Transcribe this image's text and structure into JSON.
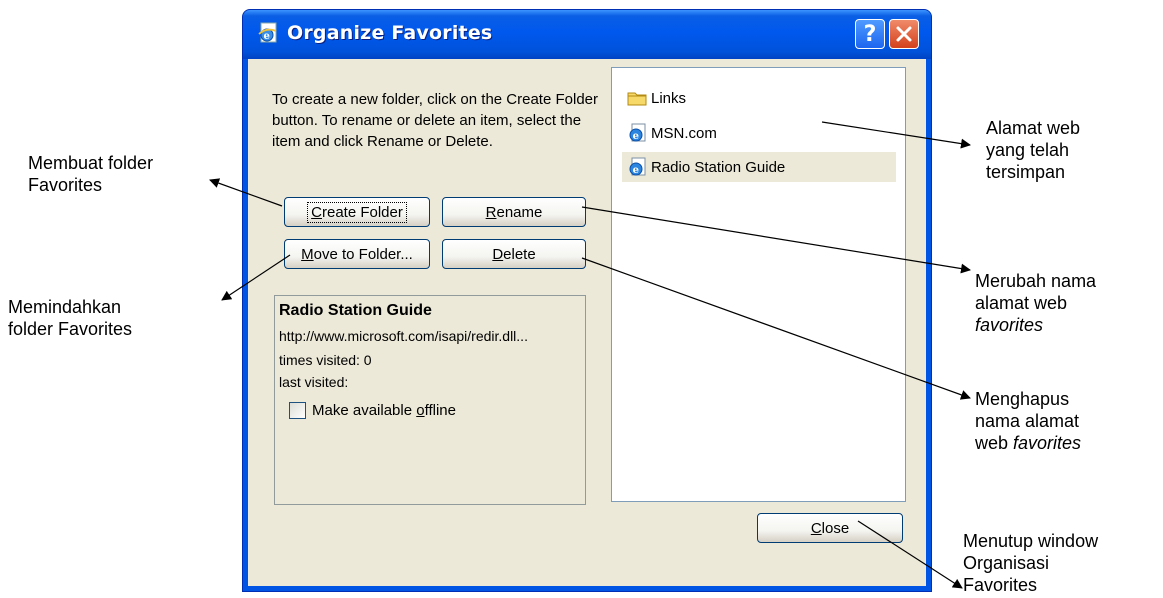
{
  "dialog": {
    "title": "Organize Favorites",
    "help_glyph": "?",
    "instructions": "To create a new folder, click on the Create Folder button. To rename or delete an item, select the item and click Rename or Delete.",
    "buttons": {
      "create_folder": {
        "pre": "",
        "u": "C",
        "post": "reate Folder"
      },
      "rename": {
        "pre": "",
        "u": "R",
        "post": "ename"
      },
      "move_to_folder": {
        "pre": "",
        "u": "M",
        "post": "ove to Folder..."
      },
      "delete": {
        "pre": "",
        "u": "D",
        "post": "elete"
      },
      "close": {
        "pre": "",
        "u": "C",
        "post": "lose"
      }
    },
    "info": {
      "name": "Radio Station Guide",
      "url": "http://www.microsoft.com/isapi/redir.dll...",
      "times_visited": "times visited: 0",
      "last_visited": "last visited:",
      "offline_pre": "Make available ",
      "offline_u": "o",
      "offline_post": "ffline",
      "offline_checked": false
    },
    "list": [
      {
        "label": "Links",
        "icon": "folder-icon",
        "selected": false
      },
      {
        "label": "MSN.com",
        "icon": "ie-page-icon",
        "selected": false
      },
      {
        "label": "Radio Station Guide",
        "icon": "ie-page-icon",
        "selected": true
      }
    ]
  },
  "annotations": {
    "create": [
      "Membuat folder",
      "Favorites"
    ],
    "move": [
      "Memindahkan",
      "folder Favorites"
    ],
    "saved": [
      "Alamat web",
      "yang telah",
      "tersimpan"
    ],
    "rename": [
      "Merubah nama",
      "alamat web",
      "favorites"
    ],
    "delete": [
      "Menghapus",
      "nama alamat",
      "web ",
      "favorites"
    ],
    "close": [
      "Menutup window",
      "Organisasi",
      "Favorites"
    ]
  },
  "colors": {
    "titlebar": "#0058ee",
    "dialog_face": "#ece9d8",
    "close_button": "#d4401c"
  }
}
